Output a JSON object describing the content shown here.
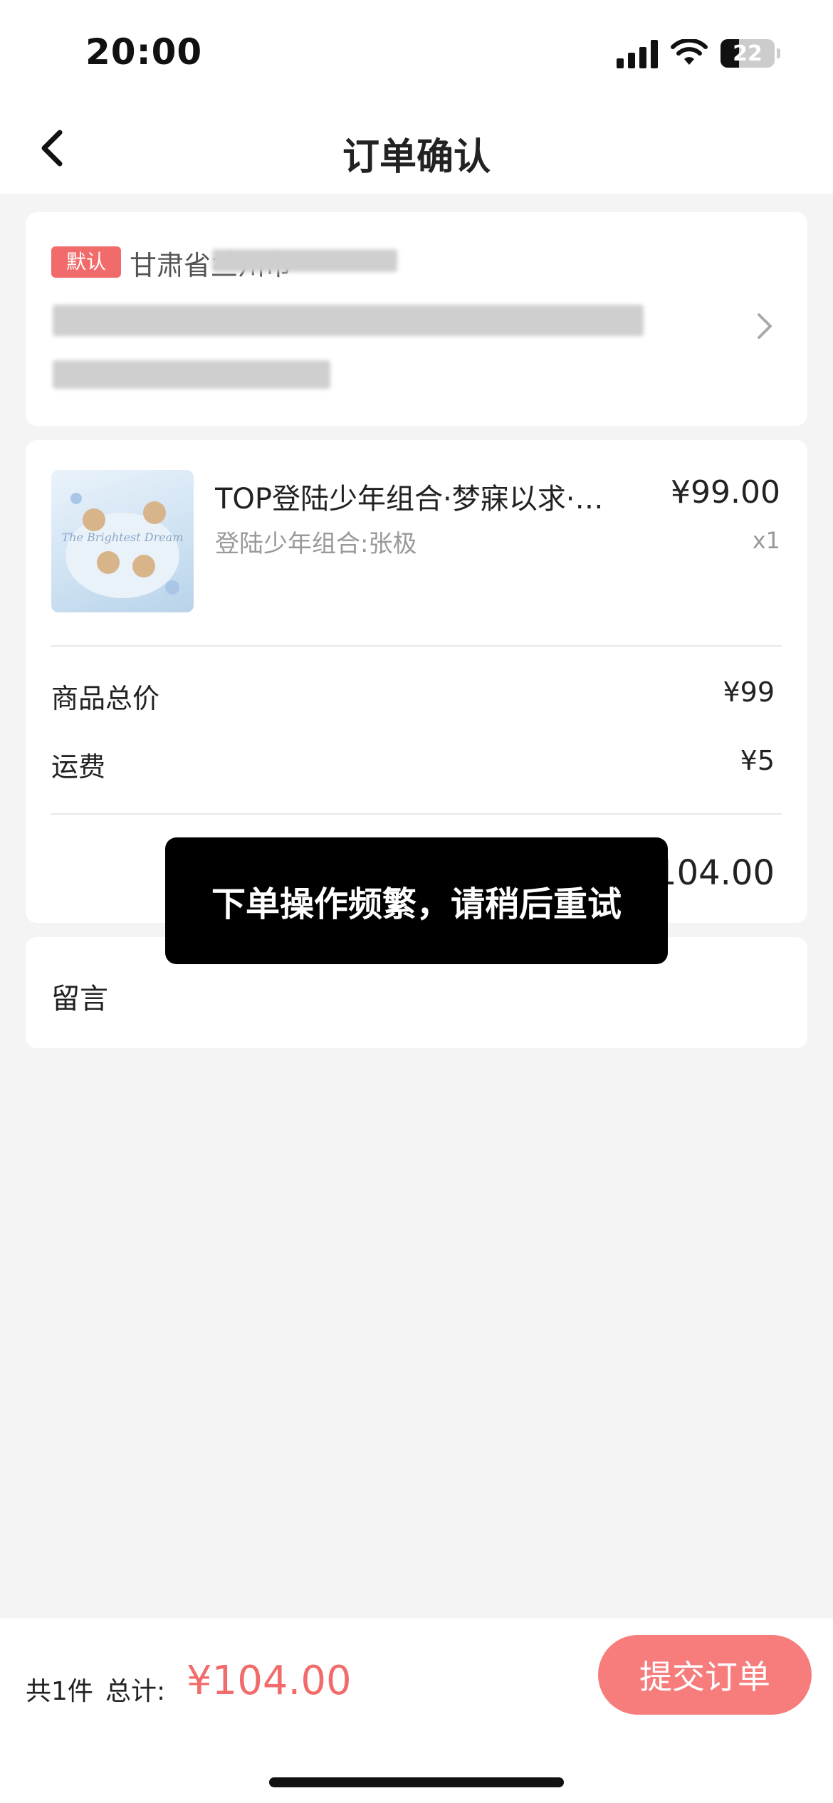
{
  "status_bar": {
    "time": "20:00",
    "battery": "22"
  },
  "nav": {
    "title": "订单确认"
  },
  "address": {
    "default_tag": "默认",
    "line1": "甘肃省兰州市"
  },
  "product": {
    "name": "TOP登陆少年组合·梦寐以求·演…",
    "price": "¥99.00",
    "spec": "登陆少年组合:张极",
    "qty": "x1",
    "image_caption": "The Brightest Dream"
  },
  "fees": {
    "goods_total_label": "商品总价",
    "goods_total_value": "¥99",
    "shipping_label": "运费",
    "shipping_value": "¥5",
    "subtotal_value": "¥104.00"
  },
  "message": {
    "label": "留言"
  },
  "toast": {
    "text": "下单操作频繁，请稍后重试"
  },
  "bottom": {
    "count": "共1件",
    "total_label": "总计:",
    "total_value": "¥104.00",
    "submit_label": "提交订单"
  },
  "colors": {
    "accent": "#f26b6b",
    "button": "#f77c7c",
    "background": "#f4f4f4"
  }
}
